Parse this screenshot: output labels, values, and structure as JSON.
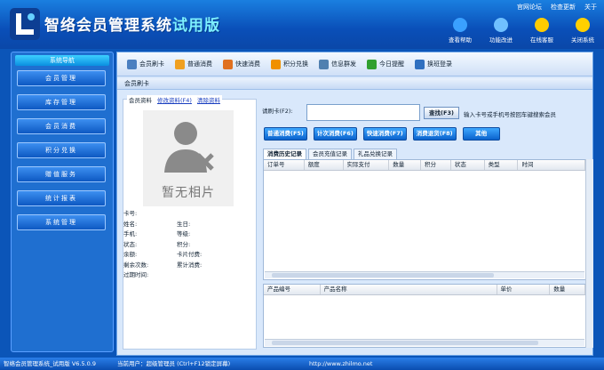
{
  "app": {
    "title_main": "智络会员管理系统",
    "title_trial": "试用版"
  },
  "toplinks": [
    "官网论坛",
    "检查更新",
    "关于"
  ],
  "topicons": [
    {
      "label": "查看帮助",
      "color": "#3aa0ff"
    },
    {
      "label": "功能改进",
      "color": "#6fc0ff"
    },
    {
      "label": "在线客服",
      "color": "#ffcc00"
    },
    {
      "label": "关闭系统",
      "color": "#ffd000"
    }
  ],
  "sidebar": {
    "heading": "系统导航",
    "items": [
      "会员管理",
      "库存管理",
      "会员消费",
      "积分兑换",
      "赠值服务",
      "统计报表",
      "系统管理"
    ]
  },
  "toolbar": [
    {
      "label": "会员刷卡",
      "color": "#4a7fc0"
    },
    {
      "label": "普通消费",
      "color": "#f0a020"
    },
    {
      "label": "快速消费",
      "color": "#e07020"
    },
    {
      "label": "积分兑换",
      "color": "#f09000"
    },
    {
      "label": "信息群发",
      "color": "#5080b0"
    },
    {
      "label": "今日提醒",
      "color": "#30a030"
    },
    {
      "label": "换班登录",
      "color": "#3070c0"
    }
  ],
  "section": {
    "title": "会员刷卡"
  },
  "member": {
    "tab_label": "会员资料",
    "link_edit": "修改资料(F4)",
    "link_clear": "清除资料",
    "photo_caption": "暂无相片",
    "fields": [
      [
        "卡号:",
        ""
      ],
      [
        "姓名:",
        "生日:"
      ],
      [
        "手机:",
        "等级:"
      ],
      [
        "状态:",
        "积分:"
      ],
      [
        "余额:",
        "卡片付费:"
      ],
      [
        "剩余次数:",
        "累计消费:"
      ],
      [
        "过期时间:",
        ""
      ]
    ]
  },
  "card": {
    "label": "请刷卡(F2):",
    "search": "查找(F3)",
    "hint": "输入卡号或手机号按回车键搜索会员"
  },
  "actions": [
    "普通消费(F5)",
    "计次消费(F6)",
    "快速消费(F7)",
    "消费退货(F8)",
    "其他"
  ],
  "tabs": [
    "消费历史记录",
    "会员充值记录",
    "礼品兑换记录"
  ],
  "grid1": {
    "columns": [
      "订单号",
      "额度",
      "实际支付",
      "数量",
      "积分",
      "状态",
      "类型",
      "时间"
    ]
  },
  "grid2": {
    "columns": [
      "产品编号",
      "产品名称",
      "单价",
      "数量"
    ]
  },
  "status": {
    "product": "智络会员管理系统_试用版 V6.5.0.9",
    "user": "当前用户：超级管理员 (Ctrl+F12锁定屏幕)",
    "url": "http://www.zhilmo.net"
  }
}
